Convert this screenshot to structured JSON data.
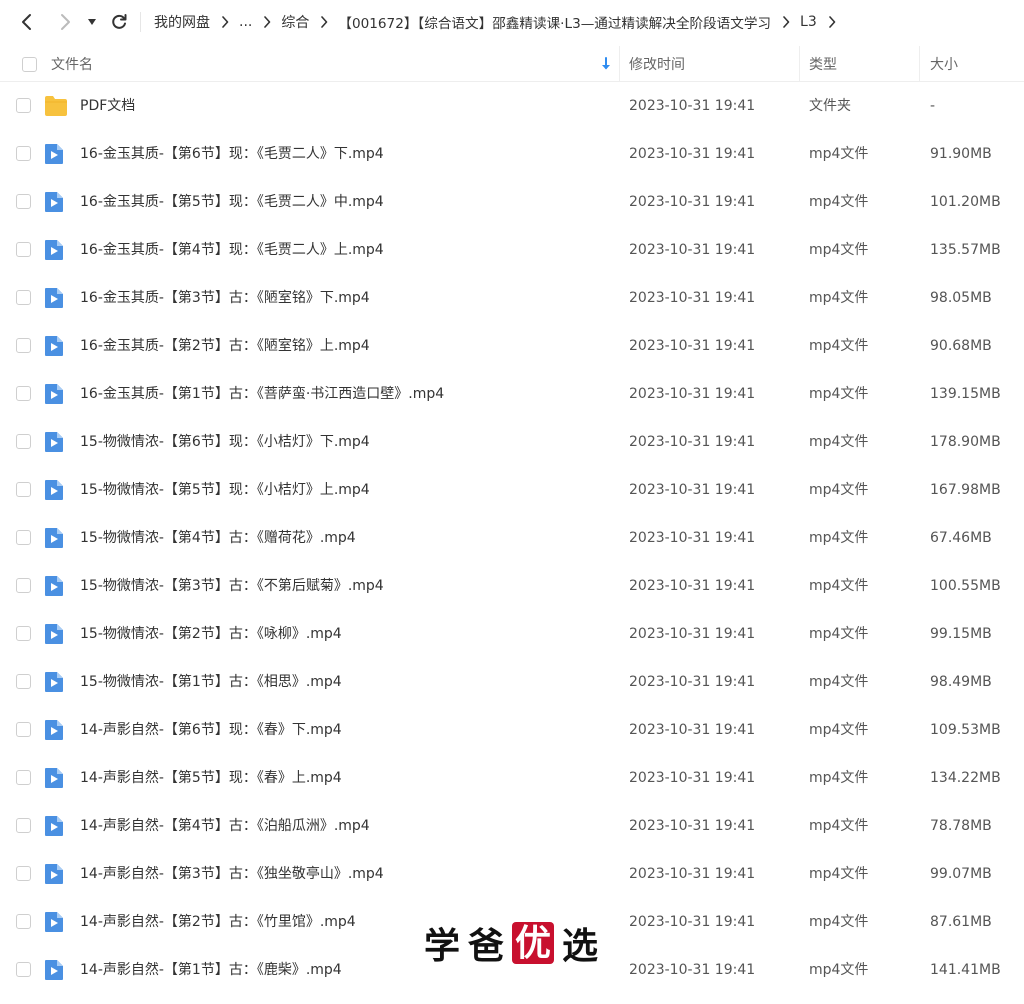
{
  "breadcrumb": [
    "我的网盘",
    "...",
    "综合",
    "【001672】【综合语文】邵鑫精读课·L3—通过精读解决全阶段语文学习",
    "L3"
  ],
  "header": {
    "name": "文件名",
    "modified": "修改时间",
    "type": "类型",
    "size": "大小"
  },
  "colors": {
    "folder": "#f7c23e",
    "video_icon": "#4a90e2",
    "sort_arrow": "#2f8cf0"
  },
  "files": [
    {
      "icon": "folder-icon",
      "name": "PDF文档",
      "date": "2023-10-31 19:41",
      "type": "文件夹",
      "size": "-"
    },
    {
      "icon": "video-file-icon",
      "name": "16-金玉其质-【第6节】现：《毛贾二人》下.mp4",
      "date": "2023-10-31 19:41",
      "type": "mp4文件",
      "size": "91.90MB"
    },
    {
      "icon": "video-file-icon",
      "name": "16-金玉其质-【第5节】现：《毛贾二人》中.mp4",
      "date": "2023-10-31 19:41",
      "type": "mp4文件",
      "size": "101.20MB"
    },
    {
      "icon": "video-file-icon",
      "name": "16-金玉其质-【第4节】现：《毛贾二人》上.mp4",
      "date": "2023-10-31 19:41",
      "type": "mp4文件",
      "size": "135.57MB"
    },
    {
      "icon": "video-file-icon",
      "name": "16-金玉其质-【第3节】古：《陋室铭》下.mp4",
      "date": "2023-10-31 19:41",
      "type": "mp4文件",
      "size": "98.05MB"
    },
    {
      "icon": "video-file-icon",
      "name": "16-金玉其质-【第2节】古：《陋室铭》上.mp4",
      "date": "2023-10-31 19:41",
      "type": "mp4文件",
      "size": "90.68MB"
    },
    {
      "icon": "video-file-icon",
      "name": "16-金玉其质-【第1节】古：《菩萨蛮·书江西造口壁》.mp4",
      "date": "2023-10-31 19:41",
      "type": "mp4文件",
      "size": "139.15MB"
    },
    {
      "icon": "video-file-icon",
      "name": "15-物微情浓-【第6节】现：《小桔灯》下.mp4",
      "date": "2023-10-31 19:41",
      "type": "mp4文件",
      "size": "178.90MB"
    },
    {
      "icon": "video-file-icon",
      "name": "15-物微情浓-【第5节】现：《小桔灯》上.mp4",
      "date": "2023-10-31 19:41",
      "type": "mp4文件",
      "size": "167.98MB"
    },
    {
      "icon": "video-file-icon",
      "name": "15-物微情浓-【第4节】古：《赠荷花》.mp4",
      "date": "2023-10-31 19:41",
      "type": "mp4文件",
      "size": "67.46MB"
    },
    {
      "icon": "video-file-icon",
      "name": "15-物微情浓-【第3节】古：《不第后赋菊》.mp4",
      "date": "2023-10-31 19:41",
      "type": "mp4文件",
      "size": "100.55MB"
    },
    {
      "icon": "video-file-icon",
      "name": "15-物微情浓-【第2节】古：《咏柳》.mp4",
      "date": "2023-10-31 19:41",
      "type": "mp4文件",
      "size": "99.15MB"
    },
    {
      "icon": "video-file-icon",
      "name": "15-物微情浓-【第1节】古：《相思》.mp4",
      "date": "2023-10-31 19:41",
      "type": "mp4文件",
      "size": "98.49MB"
    },
    {
      "icon": "video-file-icon",
      "name": "14-声影自然-【第6节】现：《春》下.mp4",
      "date": "2023-10-31 19:41",
      "type": "mp4文件",
      "size": "109.53MB"
    },
    {
      "icon": "video-file-icon",
      "name": "14-声影自然-【第5节】现：《春》上.mp4",
      "date": "2023-10-31 19:41",
      "type": "mp4文件",
      "size": "134.22MB"
    },
    {
      "icon": "video-file-icon",
      "name": "14-声影自然-【第4节】古：《泊船瓜洲》.mp4",
      "date": "2023-10-31 19:41",
      "type": "mp4文件",
      "size": "78.78MB"
    },
    {
      "icon": "video-file-icon",
      "name": "14-声影自然-【第3节】古：《独坐敬亭山》.mp4",
      "date": "2023-10-31 19:41",
      "type": "mp4文件",
      "size": "99.07MB"
    },
    {
      "icon": "video-file-icon",
      "name": "14-声影自然-【第2节】古：《竹里馆》.mp4",
      "date": "2023-10-31 19:41",
      "type": "mp4文件",
      "size": "87.61MB"
    },
    {
      "icon": "video-file-icon",
      "name": "14-声影自然-【第1节】古：《鹿柴》.mp4",
      "date": "2023-10-31 19:41",
      "type": "mp4文件",
      "size": "141.41MB"
    }
  ],
  "watermark": {
    "chars": [
      "学",
      "爸",
      "优",
      "选"
    ]
  }
}
